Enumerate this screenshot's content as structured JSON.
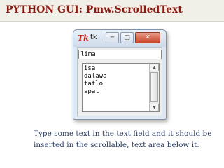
{
  "slide": {
    "title": "PYTHON GUI: Pmw.ScrolledText",
    "caption": "Type some text in the text field and it should be inserted in the scrollable, text area below it."
  },
  "window": {
    "logo": "Tk",
    "title": "tk",
    "controls": {
      "minimize": "─",
      "maximize": "□",
      "close": "✕"
    }
  },
  "entry": {
    "value": "lima"
  },
  "text_area": {
    "lines": [
      "isa",
      "dalawa",
      "tatlo",
      "apat"
    ]
  },
  "scrollbar": {
    "up": "▲",
    "down": "▼"
  },
  "colors": {
    "title": "#8b1a10",
    "caption": "#2a3c60",
    "tk_logo": "#c8200e"
  }
}
